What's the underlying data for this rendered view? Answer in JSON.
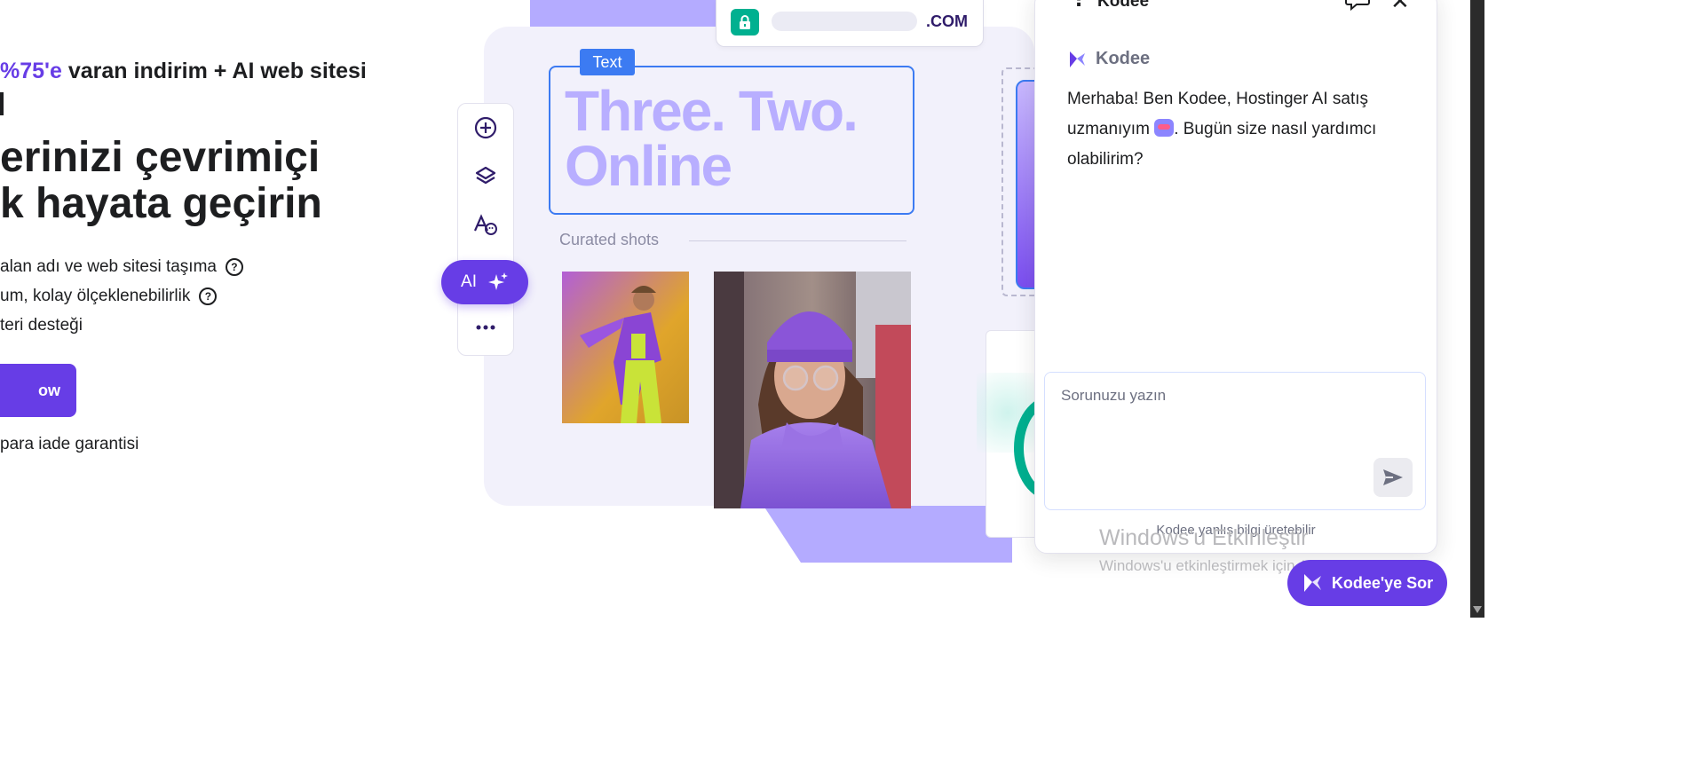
{
  "hero": {
    "promo_highlight": "%75'e",
    "promo_rest": "varan indirim + AI web sitesi",
    "headline_line1": "erinizi çevrimiçi",
    "headline_line2": "k hayata geçirin",
    "features": [
      {
        "text": "alan adı ve web sitesi taşıma",
        "help": "?"
      },
      {
        "text": "um, kolay ölçeklenebilirlik",
        "help": "?"
      },
      {
        "text": "teri desteği",
        "help": ""
      }
    ],
    "cta_label": "ow",
    "guarantee": "para iade garantisi"
  },
  "builder": {
    "domain_suffix": ".COM",
    "text_tag": "Text",
    "big_text_line1": "Three. Two.",
    "big_text_line2": "Online",
    "curated_label": "Curated shots",
    "ai_label": "AI",
    "tools": [
      "add-icon",
      "layers-icon",
      "typography-icon",
      "ai-sparkle-icon",
      "more-icon"
    ]
  },
  "chat": {
    "title": "Kodee",
    "bot_name": "Kodee",
    "message_part1": "Merhaba! Ben Kodee, Hostinger AI satış uzmanıyım",
    "message_part2": ". Bugün size nasıl yardımcı olabilirim?",
    "input_placeholder": "Sorunuzu yazın",
    "disclaimer": "Kodee yanlış bilgi üretebilir"
  },
  "windows_watermark": {
    "title": "Windows'u Etkinleştir",
    "subtitle": "Windows'u etkinleştirmek için Ayarlar'a gidin."
  },
  "ask_button": "Kodee'ye Sor",
  "colors": {
    "brand_purple": "#673de6",
    "light_purple": "#b4abff",
    "accent_blue": "#3c7bf2",
    "accent_green": "#00b090"
  }
}
